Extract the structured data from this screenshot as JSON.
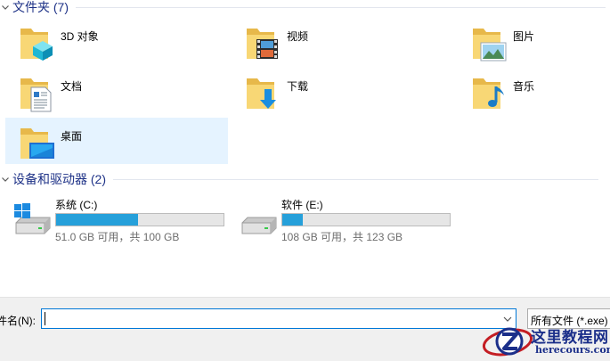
{
  "sections": {
    "folders": {
      "title": "文件夹 (7)"
    },
    "drives": {
      "title": "设备和驱动器 (2)"
    }
  },
  "folders": [
    {
      "name": "3D 对象",
      "icon": "3d-objects-folder-icon"
    },
    {
      "name": "视频",
      "icon": "videos-folder-icon"
    },
    {
      "name": "图片",
      "icon": "pictures-folder-icon"
    },
    {
      "name": "文档",
      "icon": "documents-folder-icon"
    },
    {
      "name": "下载",
      "icon": "downloads-folder-icon"
    },
    {
      "name": "音乐",
      "icon": "music-folder-icon"
    },
    {
      "name": "桌面",
      "icon": "desktop-folder-icon",
      "selected": true
    }
  ],
  "drives": [
    {
      "name": "系统 (C:)",
      "space": "51.0 GB 可用，共 100 GB",
      "used_fraction": 0.49,
      "icon": "windows-drive-icon"
    },
    {
      "name": "软件 (E:)",
      "space": "108 GB 可用，共 123 GB",
      "used_fraction": 0.122,
      "icon": "drive-icon"
    }
  ],
  "footer": {
    "filename_label": "件名(N):",
    "filename_value": "",
    "filetype": "所有文件 (*.exe)"
  },
  "watermark": {
    "title": "这里教程网",
    "url": "herecours.com"
  },
  "colors": {
    "accent": "#0078d7",
    "progress_fill": "#26a0da",
    "selected_bg": "#e5f3ff",
    "header_text": "#1e3287",
    "folder_yellow": "#f8d775"
  }
}
